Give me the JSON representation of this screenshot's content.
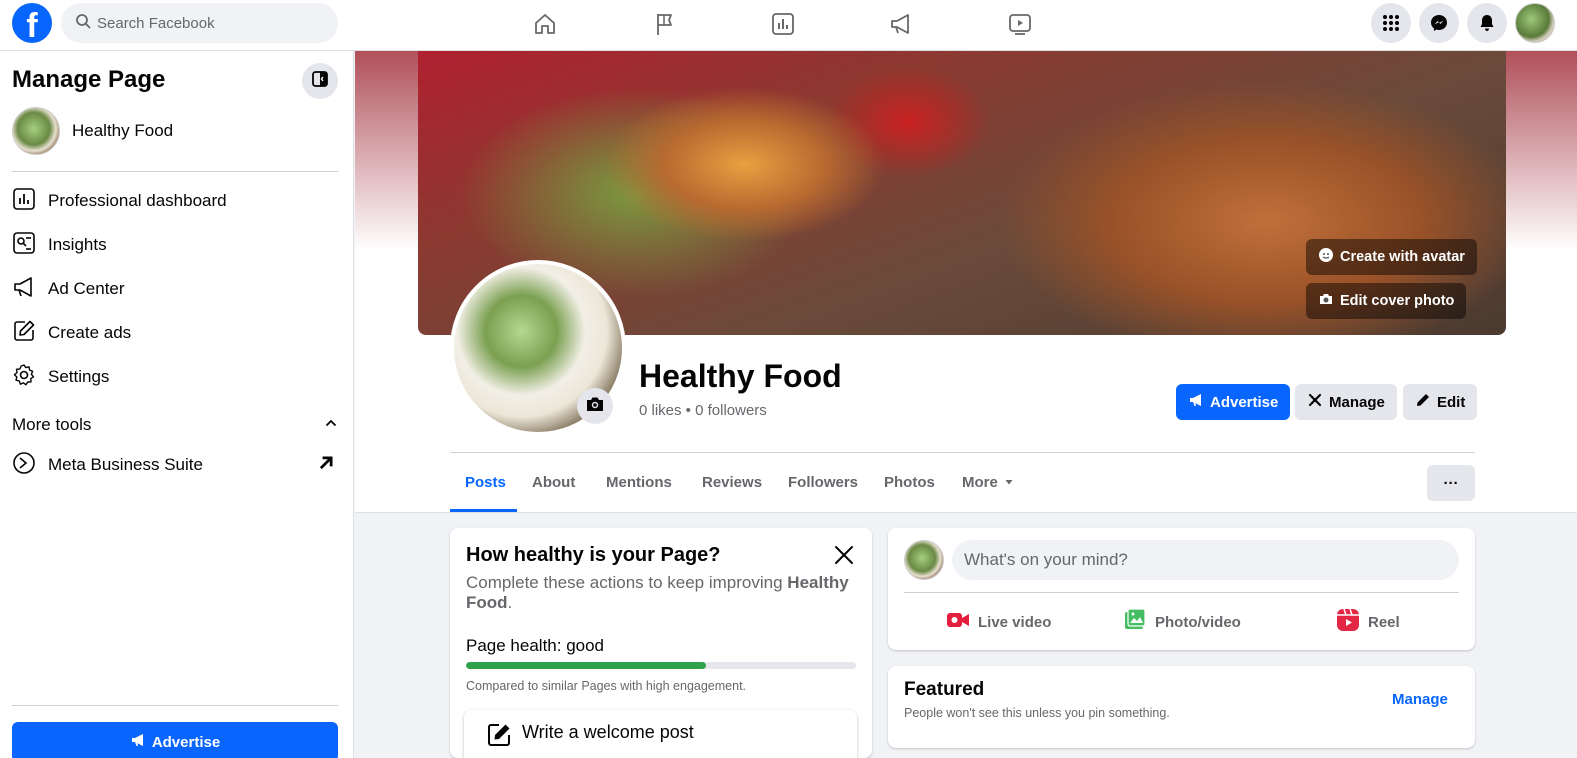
{
  "topbar": {
    "logo_letter": "f",
    "search_placeholder": "Search Facebook",
    "nav_icons": [
      "home-icon",
      "flag-icon",
      "chart-icon",
      "megaphone-icon",
      "video-icon"
    ]
  },
  "sidebar": {
    "title": "Manage Page",
    "page_name": "Healthy Food",
    "items": [
      {
        "label": "Professional dashboard",
        "icon": "dashboard-icon"
      },
      {
        "label": "Insights",
        "icon": "insights-icon"
      },
      {
        "label": "Ad Center",
        "icon": "megaphone-icon"
      },
      {
        "label": "Create ads",
        "icon": "pencil-square-icon"
      },
      {
        "label": "Settings",
        "icon": "gear-icon"
      }
    ],
    "more_tools_label": "More tools",
    "meta_business_label": "Meta Business Suite",
    "advertise_label": "Advertise"
  },
  "cover": {
    "create_avatar_label": "Create with avatar",
    "edit_cover_label": "Edit cover photo"
  },
  "page": {
    "name": "Healthy Food",
    "stats": "0 likes • 0 followers",
    "advertise_label": "Advertise",
    "manage_label": "Manage",
    "edit_label": "Edit"
  },
  "tabs": [
    {
      "label": "Posts",
      "active": true
    },
    {
      "label": "About"
    },
    {
      "label": "Mentions"
    },
    {
      "label": "Reviews"
    },
    {
      "label": "Followers"
    },
    {
      "label": "Photos"
    },
    {
      "label": "More"
    }
  ],
  "more_dots": "···",
  "health": {
    "title": "How healthy is your Page?",
    "desc_prefix": "Complete these actions to keep improving ",
    "desc_bold": "Healthy Food",
    "desc_suffix": ".",
    "label": "Page health: good",
    "progress": 0.615,
    "note": "Compared to similar Pages with high engagement.",
    "welcome_label": "Write a welcome post"
  },
  "composer": {
    "placeholder": "What's on your mind?",
    "live_label": "Live video",
    "photo_label": "Photo/video",
    "reel_label": "Reel"
  },
  "featured": {
    "title": "Featured",
    "subtitle": "People won't see this unless you pin something.",
    "manage_label": "Manage"
  },
  "colors": {
    "brand": "#0866ff",
    "health_good": "#31a24c",
    "live_red": "#e41e3f",
    "photo_green": "#45bd62",
    "reel_pink": "#e42645"
  }
}
